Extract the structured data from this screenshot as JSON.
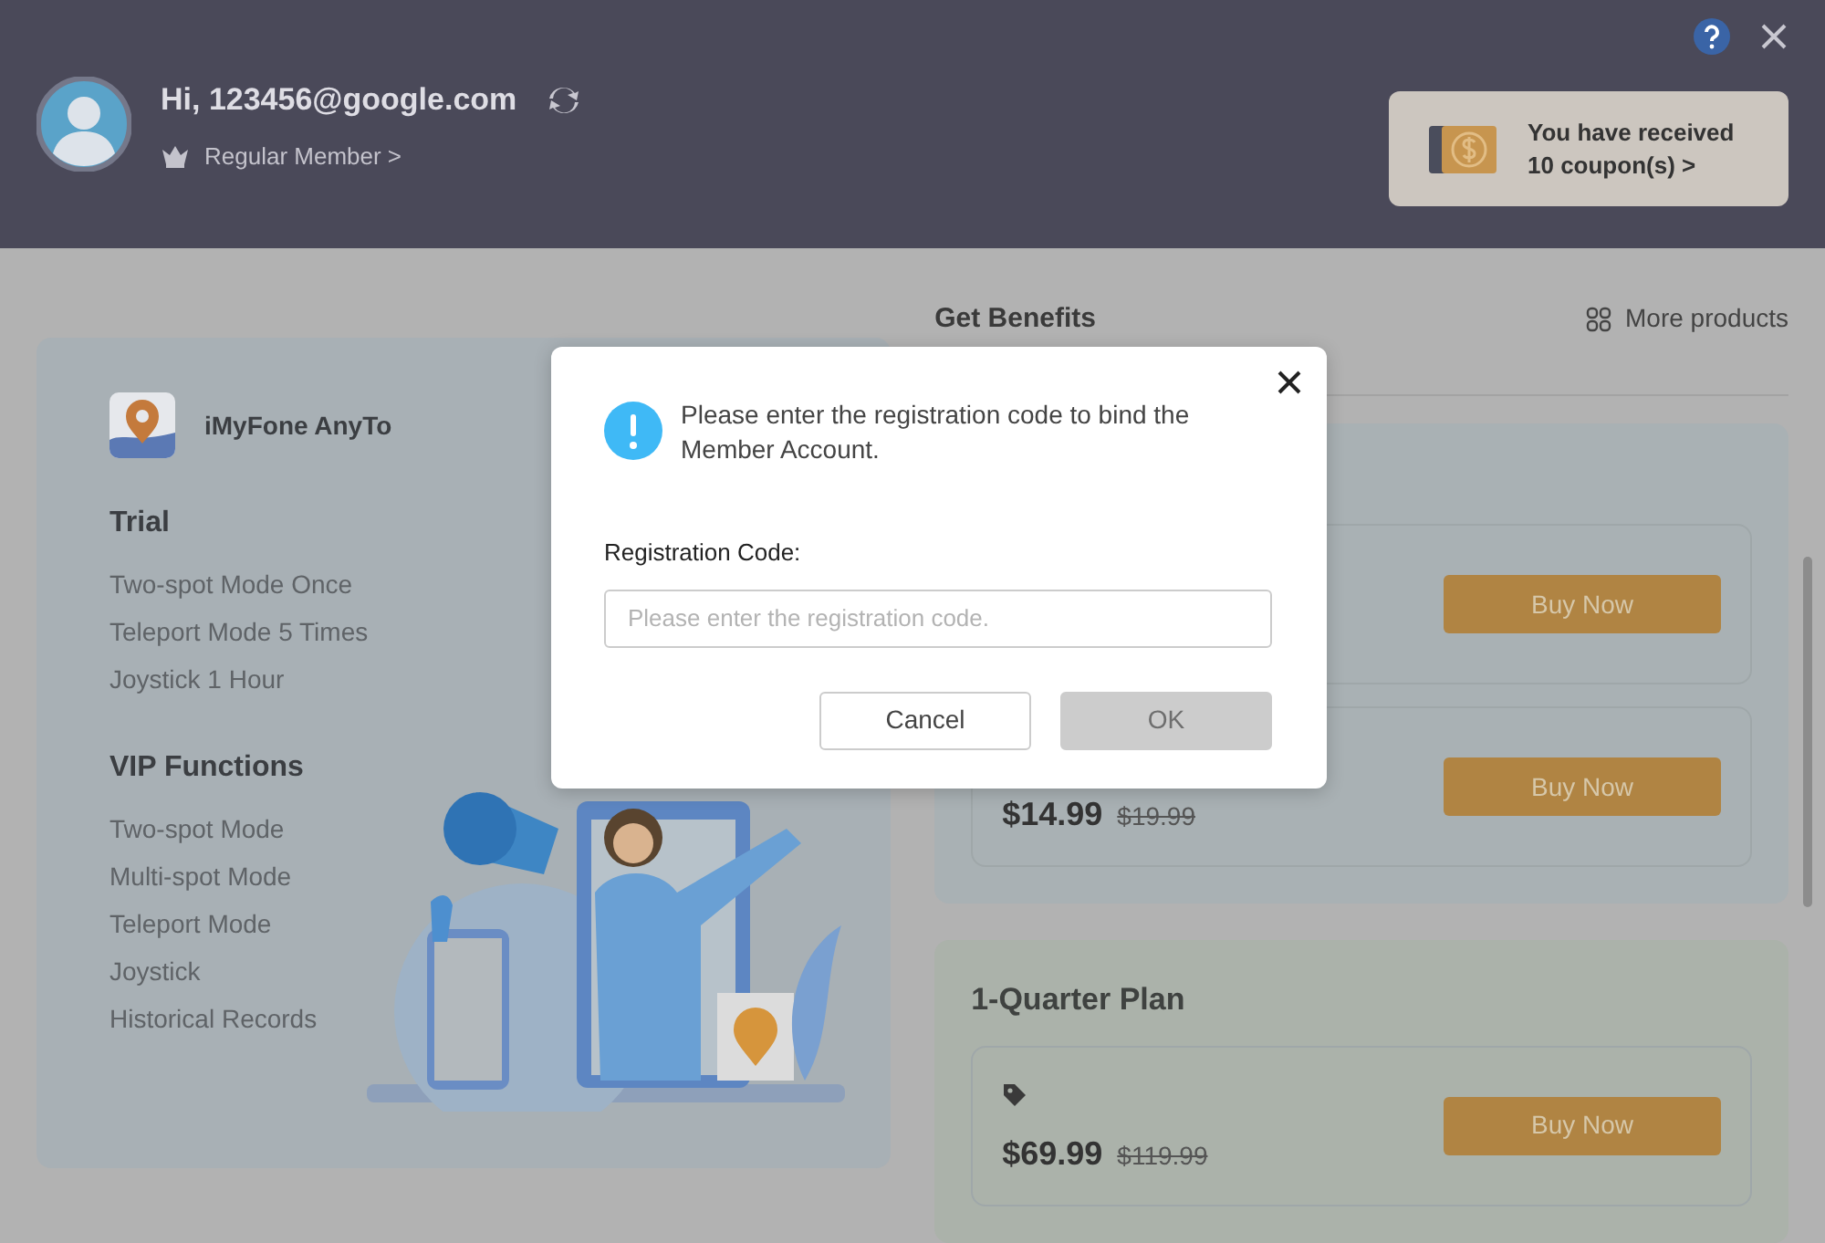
{
  "header": {
    "greeting": "Hi, 123456@google.com",
    "membership": "Regular Member >",
    "coupon": {
      "line1": "You have received",
      "line2": "10 coupon(s) >"
    }
  },
  "product": {
    "name": "iMyFone AnyTo"
  },
  "feature_groups": [
    {
      "title": "Trial",
      "items": [
        "Two-spot Mode Once",
        "Teleport Mode 5 Times",
        "Joystick 1 Hour"
      ]
    },
    {
      "title": "VIP Functions",
      "items": [
        "Two-spot Mode",
        "Multi-spot Mode",
        "Teleport Mode",
        "Joystick",
        "Historical Records"
      ]
    }
  ],
  "benefits": {
    "title": "Get Benefits",
    "more_link": "More products",
    "plan_groups": [
      {
        "plans": [
          {
            "tagged": false,
            "button": "Buy Now"
          },
          {
            "tagged": false,
            "price": "$14.99",
            "original_price": "$19.99",
            "button": "Buy Now"
          }
        ]
      },
      {
        "title": "1-Quarter Plan",
        "plans": [
          {
            "tagged": true,
            "price": "$69.99",
            "original_price": "$119.99",
            "button": "Buy Now"
          }
        ]
      }
    ]
  },
  "dialog": {
    "message": "Please enter the registration code to bind the Member Account.",
    "field_label": "Registration Code:",
    "placeholder": "Please enter the registration code.",
    "buttons": [
      {
        "label": "Cancel",
        "disabled": false
      },
      {
        "label": "OK",
        "disabled": true
      }
    ]
  }
}
